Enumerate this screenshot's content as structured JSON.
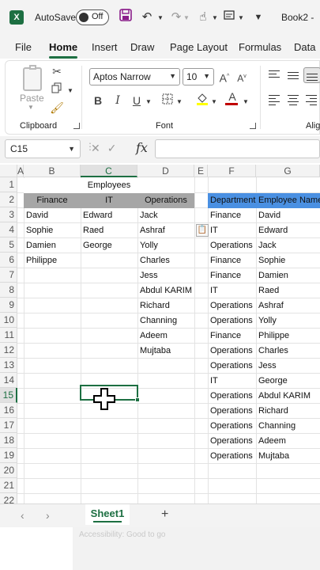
{
  "titlebar": {
    "autosave_label": "AutoSave",
    "autosave_state": "Off",
    "book_title": "Book2 -"
  },
  "ribbon_tabs": [
    "File",
    "Home",
    "Insert",
    "Draw",
    "Page Layout",
    "Formulas",
    "Data"
  ],
  "ribbon": {
    "paste_label": "Paste",
    "clipboard_label": "Clipboard",
    "font_name": "Aptos Narrow",
    "font_size": "10",
    "font_label": "Font",
    "alignment_label": "Alig",
    "bold": "B",
    "italic": "I",
    "underline": "U",
    "font_color": "#c00000",
    "fill_color": "#ffff00",
    "grow_font": "A",
    "shrink_font": "A"
  },
  "formula_bar": {
    "name_box": "C15",
    "fx": "fx",
    "formula": ""
  },
  "grid": {
    "columns": [
      "A",
      "B",
      "C",
      "D",
      "E",
      "F",
      "G"
    ],
    "selected_column": "C",
    "rows": [
      "1",
      "2",
      "3",
      "4",
      "5",
      "6",
      "7",
      "8",
      "9",
      "10",
      "11",
      "12",
      "13",
      "14",
      "15",
      "16",
      "17",
      "18",
      "19",
      "20",
      "21",
      "22"
    ],
    "selected_row": "15",
    "employees_title": "Employees",
    "left_headers": [
      "Finance",
      "IT",
      "Operations"
    ],
    "finance": [
      "David",
      "Sophie",
      "Damien",
      "Philippe"
    ],
    "it": [
      "Edward",
      "Raed",
      "George"
    ],
    "operations": [
      "Jack",
      "Ashraf",
      "Yolly",
      "Charles",
      "Jess",
      "Abdul KARIM",
      "Richard",
      "Channing",
      "Adeem",
      "Mujtaba"
    ],
    "right_headers": [
      "Department",
      "Employee Name"
    ],
    "department": [
      "Finance",
      "IT",
      "Operations",
      "Finance",
      "Finance",
      "IT",
      "Operations",
      "Operations",
      "Finance",
      "Operations",
      "Operations",
      "IT",
      "Operations",
      "Operations",
      "Operations",
      "Operations",
      "Operations"
    ],
    "employee_name": [
      "David",
      "Edward",
      "Jack",
      "Sophie",
      "Damien",
      "Raed",
      "Ashraf",
      "Yolly",
      "Philippe",
      "Charles",
      "Jess",
      "George",
      "Abdul KARIM",
      "Richard",
      "Channing",
      "Adeem",
      "Mujtaba"
    ],
    "header_gray": "#a6a6a6",
    "header_blue": "#4a90e2"
  },
  "sheets": {
    "active": "Sheet1",
    "add": "+"
  },
  "statusbar": {
    "text": "Accessibility: Good to go"
  },
  "colors": {
    "accent": "#1d6f42",
    "excel_green": "#1d6f42"
  }
}
